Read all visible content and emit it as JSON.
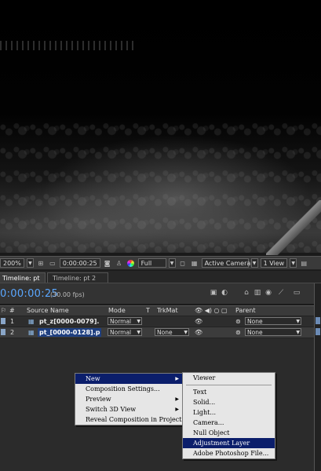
{
  "viewer_toolbar": {
    "zoom": "200%",
    "timecode": "0:00:00:25",
    "resolution": "Full",
    "camera": "Active Camera",
    "view_layout": "1 View"
  },
  "tabs": [
    {
      "label": "Timeline: pt",
      "close": "×"
    },
    {
      "label": "Timeline: pt 2"
    }
  ],
  "timeline": {
    "current_time": "0:00:00:25",
    "fps": "(30.00 fps)",
    "columns": {
      "label": "#",
      "source_name": "Source Name",
      "mode": "Mode",
      "t": "T",
      "trkmat": "TrkMat",
      "parent": "Parent"
    },
    "layers": [
      {
        "num": "1",
        "name": "pt_z[0000-0079].",
        "mode": "Normal",
        "trkmat": "",
        "parent": "None"
      },
      {
        "num": "2",
        "name": "pt_[0000-0128].p",
        "mode": "Normal",
        "trkmat": "None",
        "parent": "None"
      }
    ]
  },
  "context_menu": {
    "items": [
      {
        "label": "New",
        "submenu": true
      },
      {
        "label": "Composition Settings..."
      },
      {
        "label": "Preview",
        "submenu": true
      },
      {
        "label": "Switch 3D View",
        "submenu": true
      },
      {
        "label": "Reveal Composition in Project"
      }
    ]
  },
  "new_submenu": {
    "items": [
      {
        "label": "Viewer"
      },
      {
        "label": "Text"
      },
      {
        "label": "Solid..."
      },
      {
        "label": "Light..."
      },
      {
        "label": "Camera..."
      },
      {
        "label": "Null Object"
      },
      {
        "label": "Adjustment Layer"
      },
      {
        "label": "Adobe Photoshop File..."
      }
    ]
  },
  "colors": {
    "timecode_blue": "#5aa7ff",
    "menu_highlight": "#0b1e6b",
    "selected_name_bg": "#1f3f7f"
  }
}
